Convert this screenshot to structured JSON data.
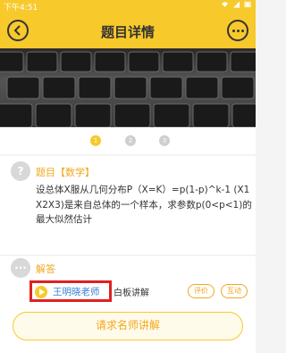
{
  "statusbar": {
    "time": "下午4:51"
  },
  "navbar": {
    "title": "题目详情"
  },
  "banner": {
    "pages": [
      "1",
      "2",
      "3"
    ]
  },
  "question": {
    "icon_glyph": "?",
    "label": "题目【数学】",
    "text": "设总体X服从几何分布P（X=K）=p(1-p)^k-1 (X1 X2X3)是来自总体的一个样本，求参数p(0<p<1)的最大似然估计"
  },
  "answer": {
    "icon_glyph": "···",
    "label": "解答",
    "teacher": "王明晓老师",
    "mode": "白板讲解",
    "rate_label": "评价",
    "interact_label": "互动",
    "request_button": "请求名师讲解"
  },
  "colors": {
    "accent": "#f7c92b",
    "highlight_box": "#e02020",
    "link": "#3a7fd5"
  }
}
